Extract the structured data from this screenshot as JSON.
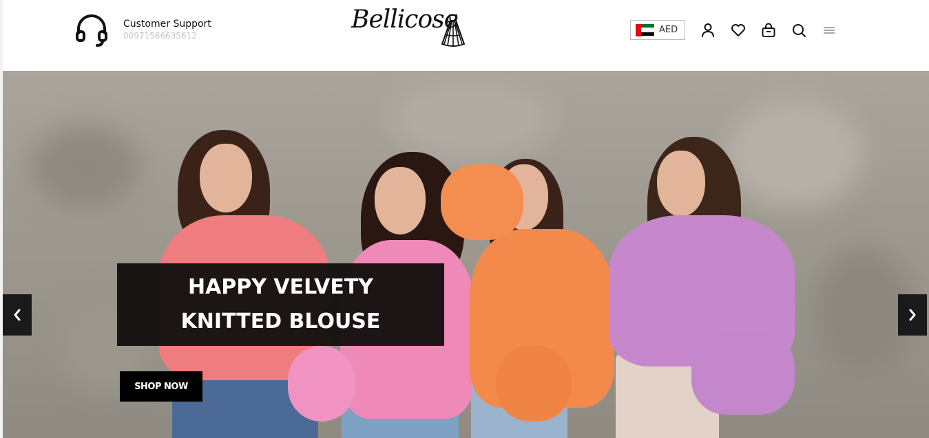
{
  "header": {
    "support": {
      "title": "Customer Support",
      "phone": "00971566635612",
      "icon": "headphones-icon"
    },
    "logo": {
      "text": "Bellicose",
      "icon": "dress-icon"
    },
    "currency": {
      "code": "AED",
      "flag": "uae-flag-icon",
      "flag_colors": {
        "red": "#e30613",
        "green": "#00732f",
        "white": "#ffffff",
        "black": "#000000"
      }
    },
    "icons": [
      "account-icon",
      "wishlist-heart-icon",
      "cart-bag-icon",
      "search-icon",
      "menu-icon"
    ]
  },
  "hero": {
    "slide_title": "HAPPY VELVETY KNITTED BLOUSE",
    "cta_label": "SHOP NOW",
    "prev_icon": "chevron-left-icon",
    "next_icon": "chevron-right-icon",
    "colors": {
      "caption_bg": "#141010",
      "cta_bg": "#000000",
      "arrow_bg": "#1a1a1a",
      "sweater_coral": "#ef7c7f",
      "sweater_pink": "#ee89b8",
      "sweater_orange": "#f38a4b",
      "sweater_lilac": "#c687cc"
    }
  }
}
